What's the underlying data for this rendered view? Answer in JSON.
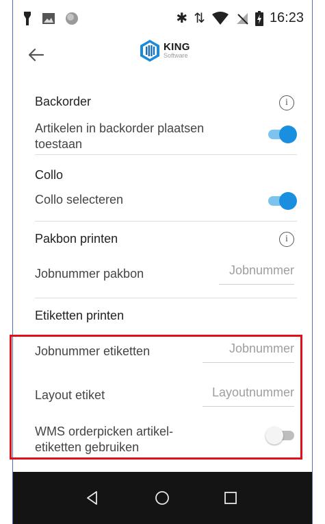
{
  "status_bar": {
    "time": "16:23",
    "icons": [
      "alarm-icon",
      "image-icon",
      "circle-icon",
      "bluetooth-icon",
      "data-arrows-icon",
      "wifi-icon",
      "no-signal-icon",
      "battery-icon"
    ]
  },
  "app_bar": {
    "back_icon": "arrow-left-icon",
    "logo_name": "KING",
    "logo_sub": "Software"
  },
  "sections": {
    "backorder": {
      "title": "Backorder",
      "label": "Artikelen in backorder plaatsen toestaan",
      "toggle_on": true
    },
    "collo": {
      "title": "Collo",
      "label": "Collo selecteren",
      "toggle_on": true
    },
    "pakbon": {
      "title": "Pakbon printen",
      "field_label": "Jobnummer pakbon",
      "field_placeholder": "Jobnummer"
    },
    "etiketten": {
      "title": "Etiketten printen",
      "job_label": "Jobnummer etiketten",
      "job_placeholder": "Jobnummer",
      "layout_label": "Layout etiket",
      "layout_placeholder": "Layoutnummer",
      "wms_label": "WMS orderpicken artikel-etiketten gebruiken",
      "wms_toggle_on": false
    }
  },
  "nav_bar": {
    "buttons": [
      "back-triangle-icon",
      "home-circle-icon",
      "recents-square-icon"
    ]
  },
  "colors": {
    "accent": "#1a8fe0",
    "highlight_border": "#e0101a",
    "nav_bg": "#141414"
  }
}
